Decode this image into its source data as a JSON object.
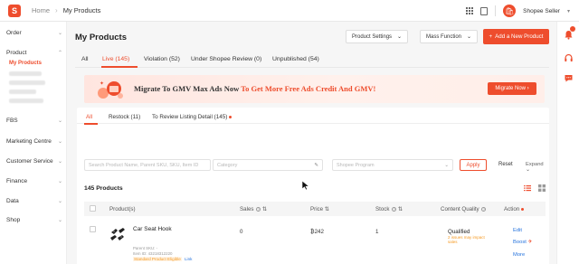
{
  "colors": {
    "brand": "#ee4d2d",
    "link": "#2673dd",
    "warning": "#f59a23"
  },
  "header": {
    "breadcrumb_home": "Home",
    "breadcrumb_current": "My Products",
    "seller_name": "Shopee Seller"
  },
  "sidebar": {
    "sections": [
      {
        "label": "Order"
      },
      {
        "label": "Product",
        "active_sub": "My Products"
      },
      {
        "label": "FBS"
      },
      {
        "label": "Marketing Centre"
      },
      {
        "label": "Customer Service"
      },
      {
        "label": "Finance"
      },
      {
        "label": "Data"
      },
      {
        "label": "Shop"
      }
    ]
  },
  "page": {
    "title": "My Products",
    "product_settings_label": "Product Settings",
    "mass_function_label": "Mass Function",
    "add_product_label": "Add a New Product"
  },
  "tabs": [
    {
      "label": "All"
    },
    {
      "label": "Live (145)"
    },
    {
      "label": "Violation (52)"
    },
    {
      "label": "Under Shopee Review (0)"
    },
    {
      "label": "Unpublished (54)"
    }
  ],
  "banner": {
    "text_main": "Migrate To GMV Max Ads Now",
    "text_accent": " To Get More Free Ads Credit And GMV!",
    "button_label": "Migrate Now"
  },
  "subtabs": [
    {
      "label": "All"
    },
    {
      "label": "Restock (11)"
    },
    {
      "label": "To Review Listing Detail (145)"
    }
  ],
  "filters": {
    "search_placeholder": "Search Product Name, Parent SKU, SKU, Item ID",
    "category_placeholder": "Category",
    "program_placeholder": "Shopee Program",
    "apply_label": "Apply",
    "reset_label": "Reset",
    "expand_label": "Expand"
  },
  "product_count": "145 Products",
  "table": {
    "headers": {
      "product": "Product(s)",
      "sales": "Sales",
      "price": "Price",
      "stock": "Stock",
      "quality": "Content Quality",
      "action": "Action"
    },
    "rows": [
      {
        "name": "Car Seat Hook",
        "parent_sku": "Parent SKU: -",
        "item_id": "Item ID: 43218312220",
        "badge": "Standard Product Eligible",
        "badge_link": "Link",
        "sales": "0",
        "price": "₿242",
        "stock": "1",
        "quality": "Qualified",
        "quality_note": "2 issues may impact sales",
        "actions": [
          "Edit",
          "Boost",
          "More"
        ]
      }
    ]
  }
}
